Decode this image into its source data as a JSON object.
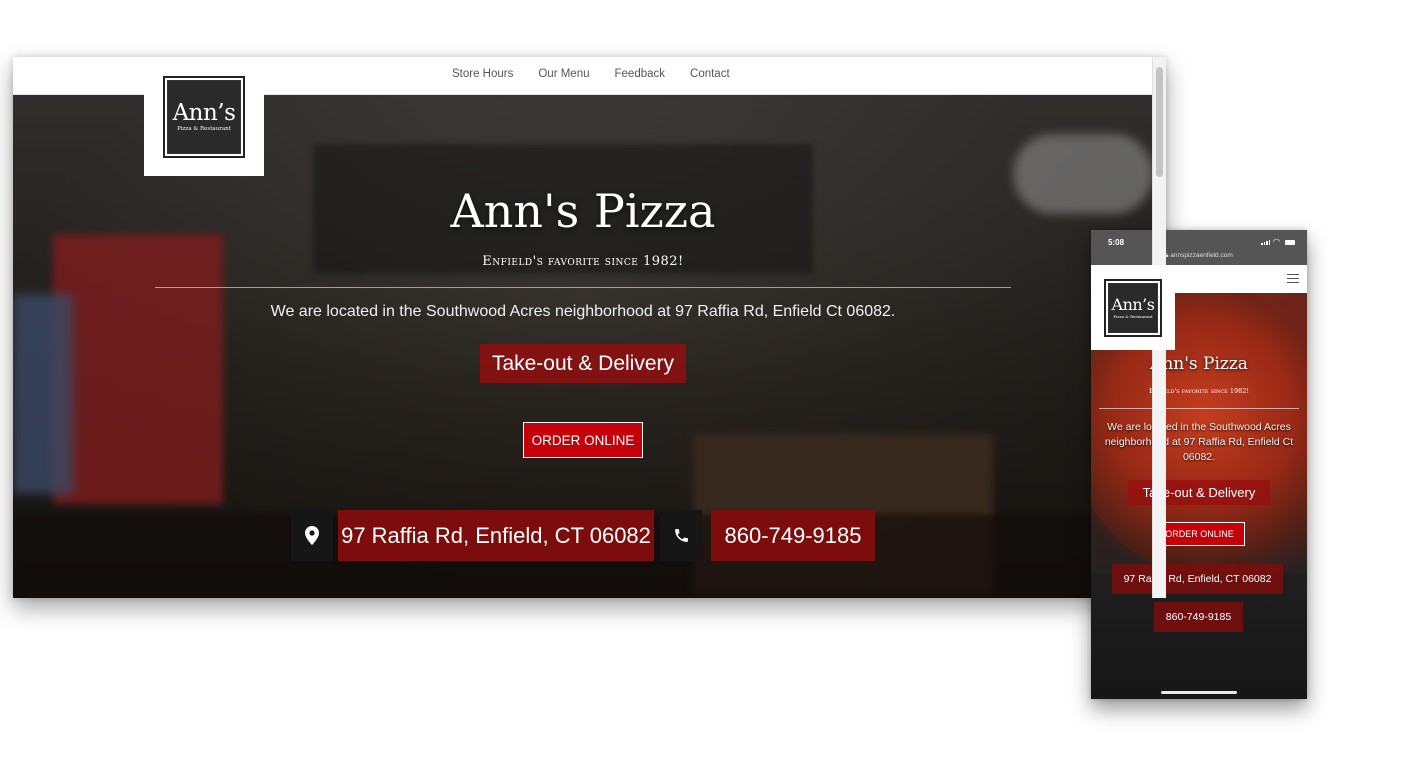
{
  "desktop": {
    "nav": {
      "items": [
        "Store Hours",
        "Our Menu",
        "Feedback",
        "Contact"
      ]
    },
    "logo": {
      "name": "Ann’s",
      "sub": "Pizza & Restaurant"
    },
    "hero": {
      "title": "Ann's Pizza",
      "tagline": "Enfield's favorite since 1982!",
      "location_text": "We are located in the Southwood Acres neighborhood at 97 Raffia Rd, Enfield Ct 06082.",
      "takeout_label": "Take-out & Delivery",
      "order_button": "ORDER ONLINE",
      "address": "97 Raffia Rd, Enfield, CT 06082",
      "phone": "860-749-9185"
    }
  },
  "mobile": {
    "status": {
      "time": "5:08"
    },
    "url": "annspizzaenfield.com",
    "logo": {
      "name": "Ann’s",
      "sub": "Pizza & Restaurant"
    },
    "hero": {
      "title": "Ann's Pizza",
      "tagline": "Enfield's favorite since 1982!",
      "location_text": "We are located in the Southwood Acres neighborhood at 97 Raffia Rd, Enfield Ct 06082.",
      "takeout_label": "Take-out & Delivery",
      "order_button": "ORDER ONLINE",
      "address": "97 Raffia Rd, Enfield, CT 06082",
      "phone": "860-749-9185"
    }
  },
  "colors": {
    "brand_red": "#c4000a",
    "banner_red": "#7d0d0d",
    "logo_dark": "#2a2a2a"
  }
}
